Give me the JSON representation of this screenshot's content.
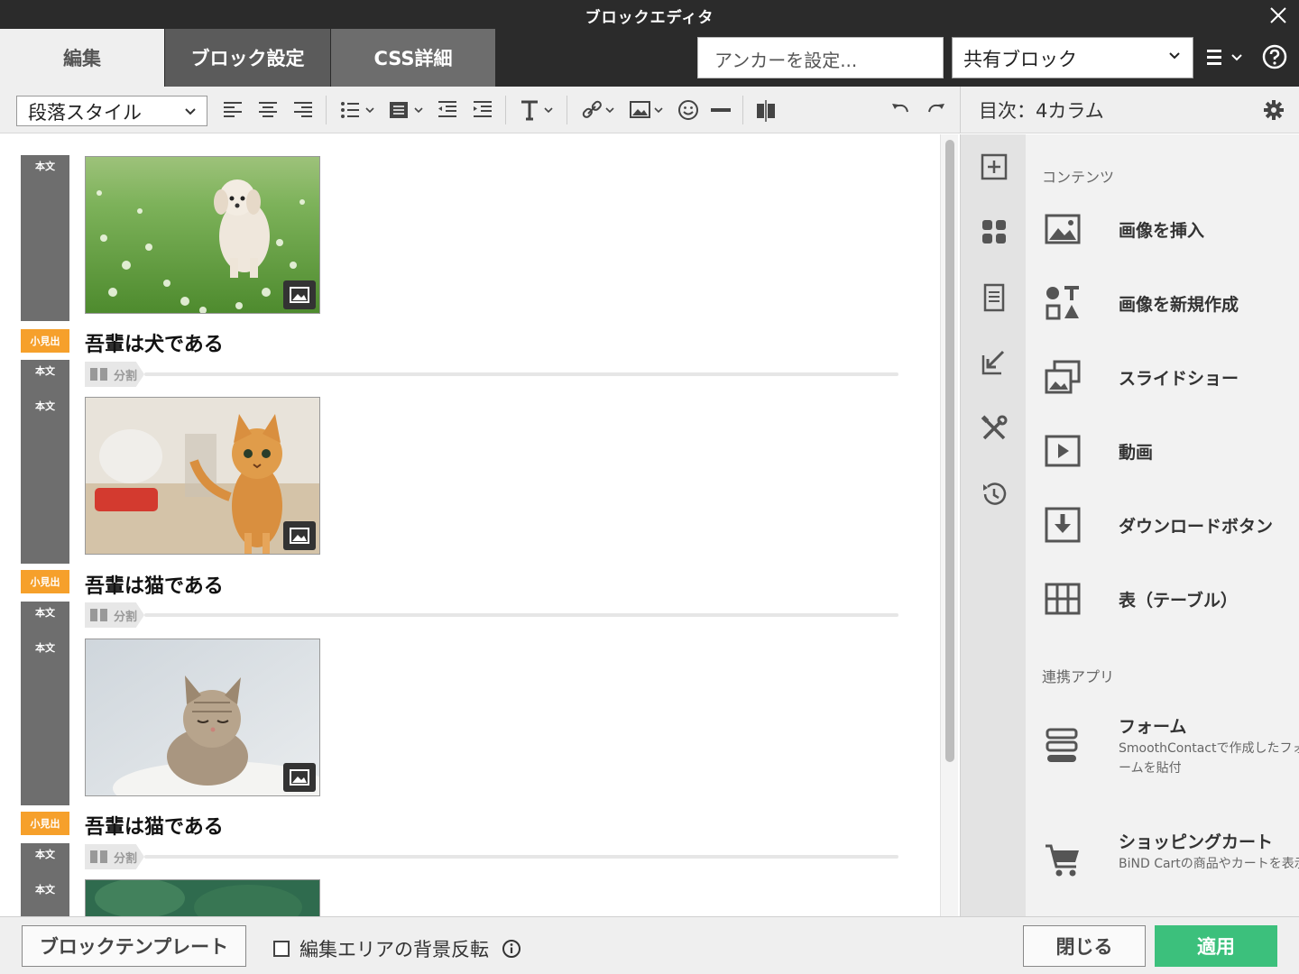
{
  "window": {
    "title": "ブロックエディタ"
  },
  "tabs": [
    {
      "label": "編集",
      "active": true
    },
    {
      "label": "ブロック設定",
      "active": false
    },
    {
      "label": "CSS詳細",
      "active": false
    }
  ],
  "header": {
    "anchor_placeholder": "アンカーを設定...",
    "shared_block": "共有ブロック"
  },
  "toolbar": {
    "paragraph_style": "段落スタイル",
    "icons": [
      "align-left-icon",
      "align-center-icon",
      "align-right-icon",
      "bullet-list-icon",
      "block-format-icon",
      "outdent-icon",
      "indent-icon",
      "text-style-icon",
      "link-icon",
      "image-icon",
      "emoji-icon",
      "horizontal-rule-icon",
      "column-split-icon",
      "undo-icon",
      "redo-icon"
    ]
  },
  "editor": {
    "labels": {
      "body": "本文",
      "subheading": "小見出",
      "split": "分割"
    },
    "blocks": [
      {
        "heading": "吾輩は犬である",
        "image": "dog-photo"
      },
      {
        "heading": "吾輩は猫である",
        "image": "kitten-standing-photo"
      },
      {
        "heading": "吾輩は猫である",
        "image": "kitten-sleeping-photo"
      }
    ]
  },
  "right_panel": {
    "title": "目次：4カラム",
    "sections": {
      "contents": "コンテンツ",
      "apps": "連携アプリ"
    },
    "content_items": [
      {
        "name": "画像を挿入",
        "icon": "image-icon"
      },
      {
        "name": "画像を新規作成",
        "icon": "shapes-icon"
      },
      {
        "name": "スライドショー",
        "icon": "slideshow-icon"
      },
      {
        "name": "動画",
        "icon": "video-icon"
      },
      {
        "name": "ダウンロードボタン",
        "icon": "download-icon"
      },
      {
        "name": "表（テーブル）",
        "icon": "table-icon"
      }
    ],
    "app_items": [
      {
        "name": "フォーム",
        "desc": "SmoothContactで作成したフォームを貼付",
        "icon": "form-icon"
      },
      {
        "name": "ショッピングカート",
        "desc": "BiND Cartの商品やカートを表示",
        "icon": "cart-icon"
      }
    ],
    "rail_icons": [
      "add-block-icon",
      "widgets-icon",
      "page-icon",
      "import-icon",
      "tools-icon",
      "history-icon"
    ]
  },
  "footer": {
    "template_button": "ブロックテンプレート",
    "bg_invert_label": "編集エリアの背景反転",
    "close_button": "閉じる",
    "apply_button": "適用"
  },
  "colors": {
    "titlebar": "#2b2b2b",
    "subheading_label": "#f6a02b",
    "body_label": "#6e6e6e",
    "apply": "#3cc07c"
  }
}
